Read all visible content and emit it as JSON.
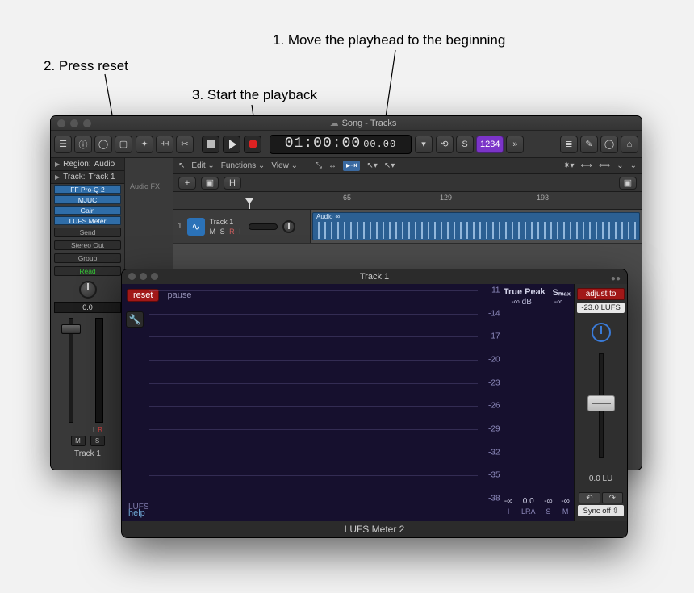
{
  "annotations": {
    "step1": "1. Move the playhead to the beginning",
    "step2": "2. Press reset",
    "step3": "3. Start the playback"
  },
  "app_window": {
    "title": "Song - Tracks",
    "toolbar": {
      "lcd_big": "01:00:00",
      "lcd_small": "00.00",
      "count_in": "1234"
    },
    "inspector": {
      "region_label": "Region:",
      "region_value": "Audio",
      "track_label": "Track:",
      "track_value": "Track 1",
      "plugins": [
        "FF Pro-Q 2",
        "MJUC",
        "Gain",
        "LUFS Meter"
      ],
      "send": "Send",
      "output": "Stereo Out",
      "group": "Group",
      "read": "Read",
      "db": "0.0",
      "m": "M",
      "s": "S",
      "i": "I",
      "r": "R",
      "track_name": "Track 1"
    },
    "fxzone": "Audio FX",
    "editbar": {
      "edit": "Edit",
      "functions": "Functions",
      "view": "View"
    },
    "ruler": {
      "t1": "65",
      "t2": "129",
      "t3": "193"
    },
    "trackrow": {
      "idx": "1",
      "name": "Track 1",
      "m": "M",
      "s": "S",
      "r": "R",
      "i": "I"
    },
    "region_name": "Audio"
  },
  "plugin": {
    "title": "Track 1",
    "name": "LUFS Meter 2",
    "reset": "reset",
    "pause": "pause",
    "help": "help",
    "lufs": "LUFS",
    "grid": [
      "-11",
      "-14",
      "-17",
      "-20",
      "-23",
      "-26",
      "-29",
      "-32",
      "-35",
      "-38"
    ],
    "truepeak_label": "True Peak",
    "truepeak_val": "-∞ dB",
    "smax_label": "Sₘₐₓ",
    "smax_val": "-∞",
    "adjust": "adjust to",
    "adjust_target": "-23.0 LUFS",
    "lu": "0.0 LU",
    "sync": "Sync off",
    "readouts": {
      "i": {
        "v": "-∞",
        "l": "I"
      },
      "lra": {
        "v": "0.0",
        "l": "LRA"
      },
      "s": {
        "v": "-∞",
        "l": "S"
      },
      "m": {
        "v": "-∞",
        "l": "M"
      }
    }
  }
}
